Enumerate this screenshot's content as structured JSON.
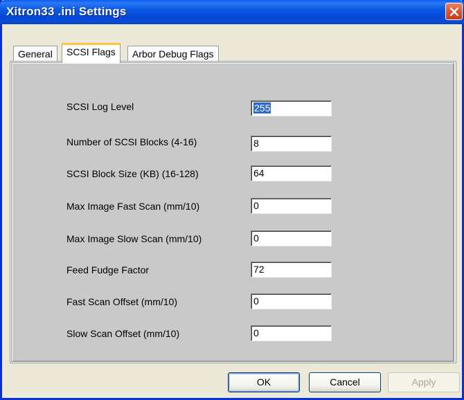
{
  "window": {
    "title": "Xitron33 .ini Settings"
  },
  "tabs": [
    {
      "label": "General",
      "active": false
    },
    {
      "label": "SCSI Flags",
      "active": true
    },
    {
      "label": "Arbor Debug Flags",
      "active": false
    }
  ],
  "settings": [
    {
      "label": "SCSI Log Level",
      "value": "255",
      "selected": true
    },
    {
      "label": "Number of SCSI Blocks (4-16)",
      "value": "8"
    },
    {
      "label": "SCSI Block Size (KB) (16-128)",
      "value": "64"
    },
    {
      "label": "Max Image Fast Scan (mm/10)",
      "value": "0"
    },
    {
      "label": "Max Image Slow Scan (mm/10)",
      "value": "0"
    },
    {
      "label": "Feed Fudge Factor",
      "value": "72"
    },
    {
      "label": "Fast Scan Offset (mm/10)",
      "value": "0"
    },
    {
      "label": "Slow Scan Offset (mm/10)",
      "value": "0"
    }
  ],
  "buttons": {
    "ok": "OK",
    "cancel": "Cancel",
    "apply": "Apply"
  },
  "colors": {
    "title_bar": "#0a4cd4",
    "panel_background": "#c9c9c9",
    "selection": "#316ac5",
    "active_tab_accent": "#ffc83c"
  }
}
